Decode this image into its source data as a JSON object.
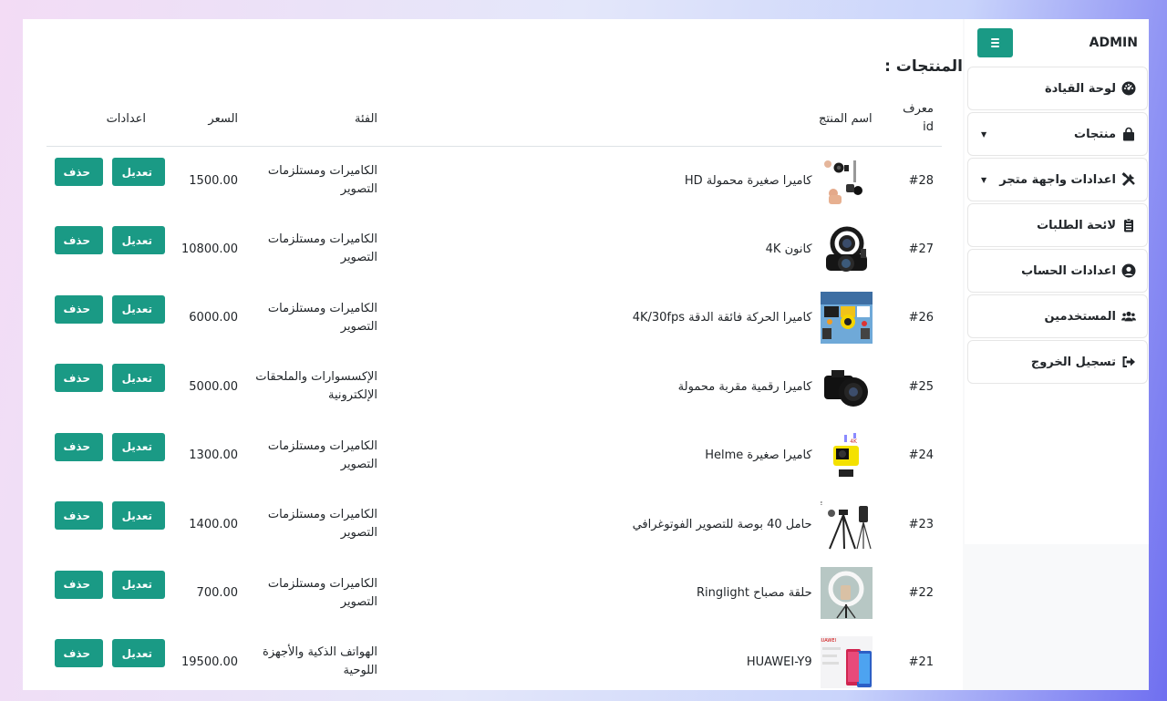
{
  "sidebar": {
    "brand": "ADMIN",
    "items": [
      {
        "label": "لوحة القيادة",
        "icon": "dashboard-icon"
      },
      {
        "label": "منتجات",
        "icon": "shopping-bag-icon",
        "has_caret": true
      },
      {
        "label": "اعدادات واجهة متجر",
        "icon": "tools-icon",
        "has_caret": true
      },
      {
        "label": "لائحة الطلبات",
        "icon": "clipboard-list-icon"
      },
      {
        "label": "اعدادات الحساب",
        "icon": "user-circle-icon"
      },
      {
        "label": "المستخدمين",
        "icon": "users-icon"
      },
      {
        "label": "تسجيل الخروج",
        "icon": "sign-out-icon"
      }
    ],
    "caret": "▼"
  },
  "page": {
    "title": "المنتجات :"
  },
  "table": {
    "headers": {
      "id": "معرف id",
      "name": "اسم المنتج",
      "category": "الفئة",
      "price": "السعر",
      "actions": "اعدادات"
    },
    "edit_label": "تعديل",
    "delete_label": "حذف",
    "rows": [
      {
        "id": "#28",
        "name": "كاميرا صغيرة محمولة HD",
        "category": "الكاميرات ومستلزمات التصوير",
        "price": "1500.00",
        "thumb": "mini-camera-thumbnail"
      },
      {
        "id": "#27",
        "name": "كانون 4K",
        "category": "الكاميرات ومستلزمات التصوير",
        "price": "10800.00",
        "thumb": "canon-camera-thumbnail"
      },
      {
        "id": "#26",
        "name": "كاميرا الحركة فائقة الدقة 4K/30fps",
        "category": "الكاميرات ومستلزمات التصوير",
        "price": "6000.00",
        "thumb": "action-camera-thumbnail"
      },
      {
        "id": "#25",
        "name": "كاميرا رقمية مقربة محمولة",
        "category": "الإكسسوارات والملحقات الإلكترونية",
        "price": "5000.00",
        "thumb": "digital-camera-thumbnail"
      },
      {
        "id": "#24",
        "name": "كاميرا صغيرة Helme",
        "category": "الكاميرات ومستلزمات التصوير",
        "price": "1300.00",
        "thumb": "helmet-camera-thumbnail"
      },
      {
        "id": "#23",
        "name": "حامل 40 بوصة للتصوير الفوتوغرافي",
        "category": "الكاميرات ومستلزمات التصوير",
        "price": "1400.00",
        "thumb": "tripod-thumbnail"
      },
      {
        "id": "#22",
        "name": "حلقة مصباح Ringlight",
        "category": "الكاميرات ومستلزمات التصوير",
        "price": "700.00",
        "thumb": "ringlight-thumbnail"
      },
      {
        "id": "#21",
        "name": "HUAWEI-Y9",
        "category": "الهواتف الذكية والأجهزة اللوحية",
        "price": "19500.00",
        "thumb": "huawei-phone-thumbnail"
      }
    ]
  },
  "colors": {
    "accent": "#1a9a85"
  }
}
